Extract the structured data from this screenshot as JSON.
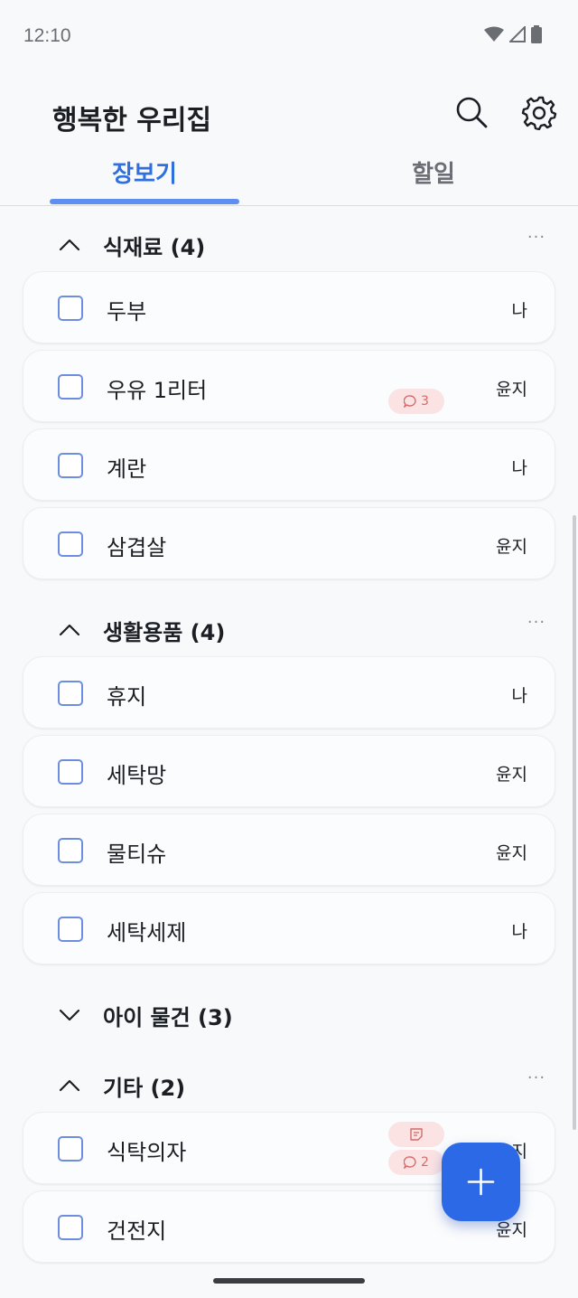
{
  "status": {
    "time": "12:10"
  },
  "header": {
    "title": "행복한 우리집"
  },
  "tabs": [
    {
      "label": "장보기"
    },
    {
      "label": "할일"
    }
  ],
  "sections": [
    {
      "title": "식재료 (4)",
      "items": [
        {
          "name": "두부",
          "assignee": "나"
        },
        {
          "name": "우유 1리터",
          "assignee": "윤지",
          "comments": "3"
        },
        {
          "name": "계란",
          "assignee": "나"
        },
        {
          "name": "삼겹살",
          "assignee": "윤지"
        }
      ]
    },
    {
      "title": "생활용품 (4)",
      "items": [
        {
          "name": "휴지",
          "assignee": "나"
        },
        {
          "name": "세탁망",
          "assignee": "윤지"
        },
        {
          "name": "물티슈",
          "assignee": "윤지"
        },
        {
          "name": "세탁세제",
          "assignee": "나"
        }
      ]
    },
    {
      "title": "아이 물건 (3)"
    },
    {
      "title": "기타 (2)",
      "items": [
        {
          "name": "식탁의자",
          "assignee": "윤지",
          "comments": "2"
        },
        {
          "name": "건전지",
          "assignee": "윤지"
        }
      ]
    }
  ],
  "more_label": "···"
}
